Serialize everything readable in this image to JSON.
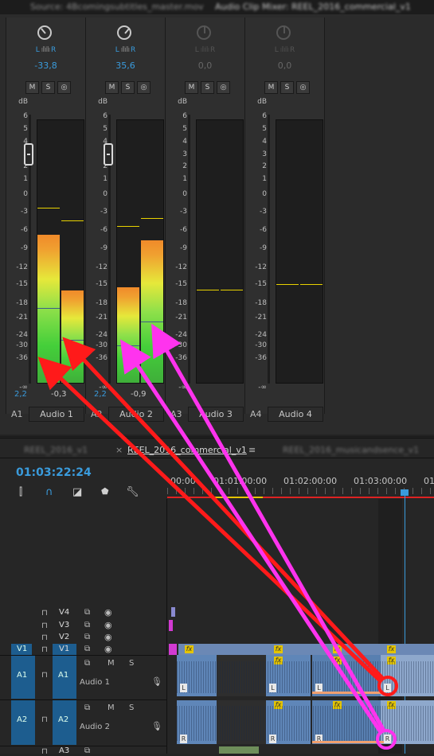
{
  "top_tabs": {
    "source": "Source: 4Bcomingsubtitles_master.mov",
    "mixer": "Audio Clip Mixer: REEL_2016_commercial_v1"
  },
  "mixer": {
    "channels": [
      {
        "id": "A1",
        "name": "Audio 1",
        "pan": "-33,8",
        "level": "2,2",
        "level_r": "-0,3",
        "active": true
      },
      {
        "id": "A2",
        "name": "Audio 2",
        "pan": "35,6",
        "level": "2,2",
        "level_r": "-0,9",
        "active": true
      },
      {
        "id": "A3",
        "name": "Audio 3",
        "pan": "0,0",
        "level": "",
        "level_r": "",
        "active": false
      },
      {
        "id": "A4",
        "name": "Audio 4",
        "pan": "0,0",
        "level": "",
        "level_r": "",
        "active": false
      }
    ],
    "lr_label": "L",
    "lr_label_r": "R",
    "buttons": [
      "M",
      "S",
      "◎"
    ],
    "db_unit": "dB",
    "db_ticks": [
      "6",
      "5",
      "4",
      "3",
      "2",
      "1",
      "0",
      "-3",
      "-6",
      "-9",
      "-12",
      "-15",
      "-18",
      "-21",
      "-24",
      "-30",
      "-36",
      "-∞"
    ],
    "meter_levels": [
      {
        "l_fill": 0.56,
        "r_fill": 0.35,
        "l_peak": 0.66,
        "r_peak": 0.61,
        "l_rms": 0.28,
        "r_rms": 0.16
      },
      {
        "l_fill": 0.36,
        "r_fill": 0.54,
        "l_peak": 0.59,
        "r_peak": 0.62,
        "l_rms": 0.14,
        "r_rms": 0.23
      },
      {
        "l_fill": 0,
        "r_fill": 0,
        "l_peak": 0.35,
        "r_peak": 0.35,
        "l_rms": 0,
        "r_rms": 0
      },
      {
        "l_fill": 0,
        "r_fill": 0,
        "l_peak": 0.37,
        "r_peak": 0.37,
        "l_rms": 0,
        "r_rms": 0
      }
    ]
  },
  "timeline": {
    "tabs": [
      "REEL_2016_v1",
      "REEL_2016_commercial_v1",
      "REEL_2016_musicandsence_v1"
    ],
    "active_tab": "REEL_2016_commercial_v1",
    "timecode": "01:03:22:24",
    "ruler": [
      "00:00",
      "01:01:00:00",
      "01:02:00:00",
      "01:03:00:00",
      "01"
    ],
    "video_tracks": [
      "V4",
      "V3",
      "V2",
      "V1"
    ],
    "audio_tracks": [
      {
        "src": "A1",
        "target": "A1",
        "name": "Audio 1"
      },
      {
        "src": "A2",
        "target": "A2",
        "name": "Audio 2"
      },
      {
        "src": "",
        "target": "A3",
        "name": ""
      }
    ],
    "source_v1": "V1",
    "mute": "M",
    "solo": "S",
    "fx": "fx",
    "badge_l": "L",
    "badge_r": "R"
  },
  "colors": {
    "accent": "#3a9bdc",
    "arrow_red": "#ff1a1a",
    "arrow_pink": "#ff33ee"
  }
}
